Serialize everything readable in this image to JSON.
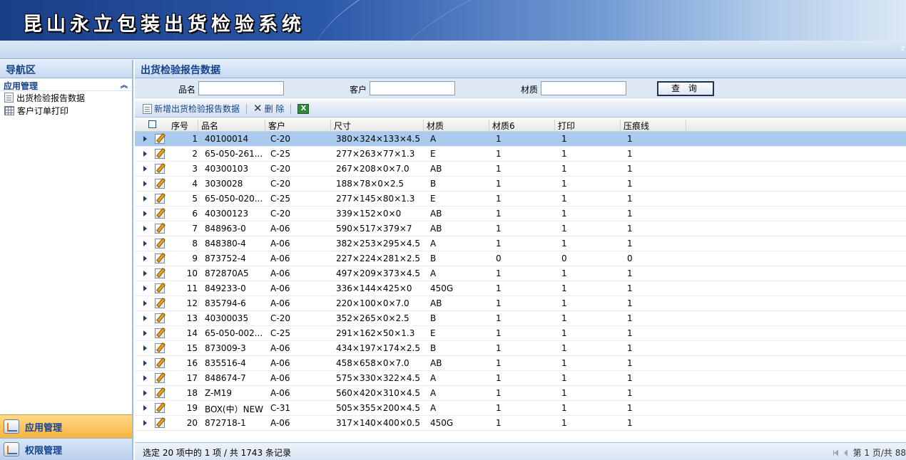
{
  "app": {
    "title": "昆山永立包装出货检验系统",
    "corner_mark": "z"
  },
  "nav": {
    "header": "导航区",
    "section": "应用管理",
    "items": [
      {
        "label": "出货检验报告数据",
        "icon": "document-icon"
      },
      {
        "label": "客户订单打印",
        "icon": "grid-icon"
      }
    ],
    "bottom": [
      {
        "label": "应用管理",
        "active": true
      },
      {
        "label": "权限管理",
        "active": false
      }
    ]
  },
  "main": {
    "title": "出货检验报告数据",
    "search": {
      "product_label": "品名",
      "product_value": "",
      "customer_label": "客户",
      "customer_value": "",
      "material_label": "材质",
      "material_value": "",
      "query_button": "查 询"
    },
    "toolbar": {
      "add_label": "新增出货检验报告数据",
      "delete_label": "删 除"
    },
    "columns": [
      "序号",
      "品名",
      "客户",
      "尺寸",
      "材质",
      "材质6",
      "打印",
      "压痕线"
    ],
    "rows": [
      [
        "1",
        "40100014",
        "C-20",
        "380×324×133×4.5",
        "A",
        "1",
        "1",
        "1"
      ],
      [
        "2",
        "65-050-261...",
        "C-25",
        "277×263×77×1.3",
        "E",
        "1",
        "1",
        "1"
      ],
      [
        "3",
        "40300103",
        "C-20",
        "267×208×0×7.0",
        "AB",
        "1",
        "1",
        "1"
      ],
      [
        "4",
        "3030028",
        "C-20",
        "188×78×0×2.5",
        "B",
        "1",
        "1",
        "1"
      ],
      [
        "5",
        "65-050-020...",
        "C-25",
        "277×145×80×1.3",
        "E",
        "1",
        "1",
        "1"
      ],
      [
        "6",
        "40300123",
        "C-20",
        "339×152×0×0",
        "AB",
        "1",
        "1",
        "1"
      ],
      [
        "7",
        "848963-0",
        "A-06",
        "590×517×379×7",
        "AB",
        "1",
        "1",
        "1"
      ],
      [
        "8",
        "848380-4",
        "A-06",
        "382×253×295×4.5",
        "A",
        "1",
        "1",
        "1"
      ],
      [
        "9",
        "873752-4",
        "A-06",
        "227×224×281×2.5",
        "B",
        "0",
        "0",
        "0"
      ],
      [
        "10",
        "872870A5",
        "A-06",
        "497×209×373×4.5",
        "A",
        "1",
        "1",
        "1"
      ],
      [
        "11",
        "849233-0",
        "A-06",
        "336×144×425×0",
        "450G",
        "1",
        "1",
        "1"
      ],
      [
        "12",
        "835794-6",
        "A-06",
        "220×100×0×7.0",
        "AB",
        "1",
        "1",
        "1"
      ],
      [
        "13",
        "40300035",
        "C-20",
        "352×265×0×2.5",
        "B",
        "1",
        "1",
        "1"
      ],
      [
        "14",
        "65-050-002...",
        "C-25",
        "291×162×50×1.3",
        "E",
        "1",
        "1",
        "1"
      ],
      [
        "15",
        "873009-3",
        "A-06",
        "434×197×174×2.5",
        "B",
        "1",
        "1",
        "1"
      ],
      [
        "16",
        "835516-4",
        "A-06",
        "458×658×0×7.0",
        "AB",
        "1",
        "1",
        "1"
      ],
      [
        "17",
        "848674-7",
        "A-06",
        "575×330×322×4.5",
        "A",
        "1",
        "1",
        "1"
      ],
      [
        "18",
        "Z-M19",
        "A-06",
        "560×420×310×4.5",
        "A",
        "1",
        "1",
        "1"
      ],
      [
        "19",
        "BOX(中）NEW",
        "C-31",
        "505×355×200×4.5",
        "A",
        "1",
        "1",
        "1"
      ],
      [
        "20",
        "872718-1",
        "A-06",
        "317×140×400×0.5",
        "450G",
        "1",
        "1",
        "1"
      ]
    ],
    "selected_row": 0,
    "status": "选定 20 项中的 1 项 / 共 1743 条记录",
    "pager": "第 1 页/共 88"
  }
}
